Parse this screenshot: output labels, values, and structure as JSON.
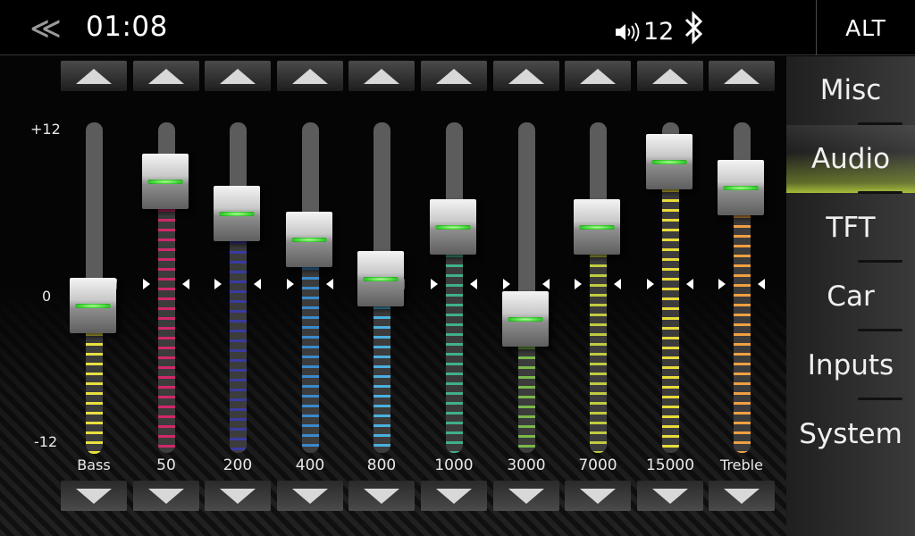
{
  "header": {
    "back_icon": "double-chevron-left-icon",
    "clock": "01:08",
    "volume_icon": "speaker-icon",
    "volume_level": "12",
    "bluetooth_icon": "bluetooth-icon",
    "alt_label": "ALT"
  },
  "scale": {
    "top": "+12",
    "middle": "0",
    "bottom": "-12"
  },
  "bands": [
    {
      "label": "Bass",
      "gain": -1.5,
      "color": "#e8e040"
    },
    {
      "label": "50",
      "gain": 8.0,
      "color": "#d0286a"
    },
    {
      "label": "200",
      "gain": 5.5,
      "color": "#3a3aa0"
    },
    {
      "label": "400",
      "gain": 3.5,
      "color": "#3a8acc"
    },
    {
      "label": "800",
      "gain": 0.5,
      "color": "#4ab0e0"
    },
    {
      "label": "1000",
      "gain": 4.5,
      "color": "#40b088"
    },
    {
      "label": "3000",
      "gain": -2.5,
      "color": "#7ab84a"
    },
    {
      "label": "7000",
      "gain": 4.5,
      "color": "#c0cc40"
    },
    {
      "label": "15000",
      "gain": 9.5,
      "color": "#e8dc3a"
    },
    {
      "label": "Treble",
      "gain": 7.5,
      "color": "#f0a040"
    }
  ],
  "sidebar": {
    "selected": "Audio",
    "items": [
      {
        "label": "Misc"
      },
      {
        "label": "Audio"
      },
      {
        "label": "TFT"
      },
      {
        "label": "Car"
      },
      {
        "label": "Inputs"
      },
      {
        "label": "System"
      }
    ]
  }
}
